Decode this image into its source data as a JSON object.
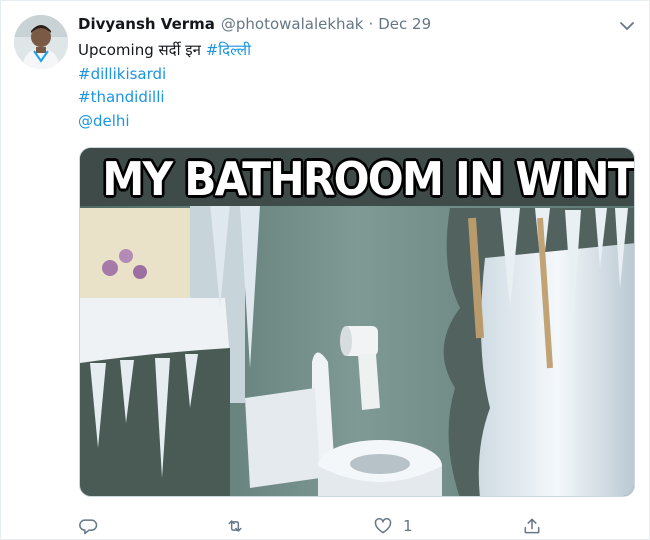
{
  "tweet": {
    "display_name": "Divyansh Verma",
    "handle": "@photowalalekhak",
    "separator": "·",
    "date": "Dec 29",
    "text_prefix": "Upcoming सर्दी इन ",
    "text_hashtag": "#दिल्ली",
    "lines": [
      "#dillikisardi",
      "#thandidilli",
      "@delhi"
    ],
    "media": {
      "caption": "MY BATHROOM IN WINTER"
    },
    "actions": {
      "reply_icon": "reply-icon",
      "retweet_icon": "retweet-icon",
      "like_icon": "heart-icon",
      "like_count": "1",
      "share_icon": "share-icon"
    },
    "menu_icon": "chevron-down-icon"
  },
  "colors": {
    "link": "#1b95e0",
    "secondary_text": "#657786",
    "icon": "#657786",
    "border": "#e6ecf0"
  }
}
